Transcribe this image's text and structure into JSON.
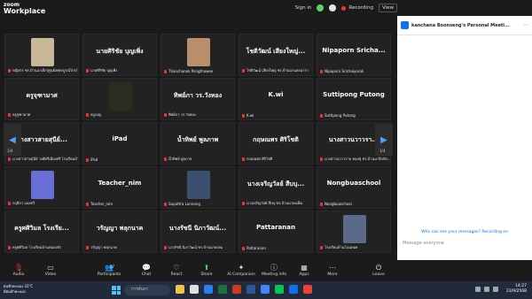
{
  "app": {
    "logo_line1": "zoom",
    "logo_line2": "Workplace"
  },
  "topbar": {
    "signin": "Sign in",
    "recording": "Recording",
    "view": "View"
  },
  "gallery": {
    "page_left": "1/4",
    "page_right": "1/4",
    "tiles": [
      {
        "big": "",
        "name": "หญิงกร ชร.บ้านนาเจ็ก(ศูนย์เพชรบูรณ์ไกร)",
        "pic": "#c9b79a"
      },
      {
        "big": "นายศิริชัย บุญเพิ่ง",
        "name": "นายศิริชัย บุญเพิ่ง",
        "pic": ""
      },
      {
        "big": "",
        "name": "Thanchanok Pongthawee",
        "pic": "#b98e6a"
      },
      {
        "big": "โชติวัฒน์ เสียงใหญ่...",
        "name": "โชติวัฒน์ เสียงใหญ่ ชร.บ้านนาแดงนารา",
        "pic": ""
      },
      {
        "big": "Nipaporn Sricha...",
        "name": "Nipaporn Srichaiyorak",
        "pic": ""
      },
      {
        "big": "ครูจุฑามาศ",
        "name": "ครูจุฑามาศ",
        "pic": ""
      },
      {
        "big": "",
        "name": "ครูเบญ",
        "pic": "#2a2d1f"
      },
      {
        "big": "ทิพย์ภา วร.วังทอง",
        "name": "ทิพย์ภา วร.วังทอง",
        "pic": ""
      },
      {
        "big": "K.wi",
        "name": "K.wi",
        "pic": ""
      },
      {
        "big": "Suttipong Putong",
        "name": "Suttipong Putong",
        "pic": ""
      },
      {
        "big": "นางสาวสายสุนีย์...",
        "name": "นางสาวสายสุนีย์ วงศ์ศรีเมืองศรี โรงเรียนบ้าน...",
        "pic": ""
      },
      {
        "big": "iPad",
        "name": "iPad",
        "pic": ""
      },
      {
        "big": "น้ำทิพย์ พูลภาพ",
        "name": "น้ำทิพย์ พูลภาพ",
        "pic": ""
      },
      {
        "big": "กฤษณพร ศิริโชติ",
        "name": "กฤษณพร ศิริโชติ",
        "pic": ""
      },
      {
        "big": "นางสาวนวาวรา...",
        "name": "นางสาวนวาวราบ ทองชุ ชร.บ้านนาจิกปัก...",
        "pic": ""
      },
      {
        "big": "",
        "name": "กฤติกา แจงทวี",
        "pic": "#6a6fd8"
      },
      {
        "big": "Teacher_nim",
        "name": "Teacher_nim",
        "pic": ""
      },
      {
        "big": "",
        "name": "Supattra Lunnong",
        "pic": "#3d4f6e"
      },
      {
        "big": "นางเจริญวัลย์ สืบบุ...",
        "name": "นางเจริญวัลย์ สืบบุ ชร.บ้านนาดงเค็ม",
        "pic": ""
      },
      {
        "big": "Nongbuaschool",
        "name": "Nongbuaschool",
        "pic": ""
      },
      {
        "big": "ครูศศิวิมล โรงเรีย...",
        "name": "ครูศศิวิมล โรงเรียนบ้านหนองบัว",
        "pic": ""
      },
      {
        "big": "วรัญญา พลุกนาค",
        "name": "วรัญญา พลุกนาค",
        "pic": ""
      },
      {
        "big": "นางรัชนี นิภาวัฒน์...",
        "name": "นางรัชนี นิภาวัฒน์ ชร.บ้านนาดงจม",
        "pic": ""
      },
      {
        "big": "Pattaranan",
        "name": "Pattaranan",
        "pic": ""
      },
      {
        "big": "",
        "name": "โรงเรียนบ้านโนนหอย",
        "pic": "#5b6a8a"
      }
    ]
  },
  "chat": {
    "title": "kanchana Boonseng's Personal Meeti...",
    "who_can_see": "Who can see your messages? Recording on",
    "placeholder": "Message everyone"
  },
  "toolbar": {
    "audio": "Audio",
    "video": "Video",
    "participants": "Participants",
    "participants_count": "57",
    "chat": "Chat",
    "react": "React",
    "share": "Share",
    "ai": "AI Companion",
    "meeting_info": "Meeting info",
    "apps": "Apps",
    "more": "More",
    "leave": "Leave"
  },
  "taskbar": {
    "weather_line1": "ฝนฟ้าคะนอง 31°C",
    "weather_line2": "มีฝนฟ้าคะนอง",
    "search": "การค้นหา",
    "time": "14:27",
    "date": "23/9/2568"
  },
  "colors": {
    "accent": "#0e71eb",
    "recording": "#e53935",
    "taskbar": "#202a3a"
  }
}
